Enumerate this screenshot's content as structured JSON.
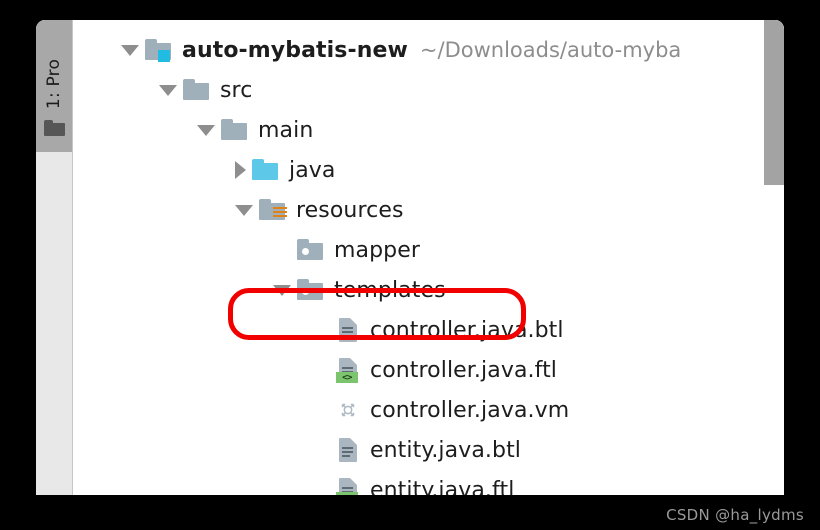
{
  "tool_window": {
    "tab_label": "1: Pro",
    "tab_icon": "project-folder-icon"
  },
  "tree": {
    "rows": [
      {
        "label": "auto-mybatis-new",
        "path": "~/Downloads/auto-myba",
        "icon": "module-folder-icon",
        "arrow": "down",
        "depth": 0,
        "bold": true
      },
      {
        "label": "src",
        "icon": "folder-icon",
        "arrow": "down",
        "depth": 1,
        "bold": false
      },
      {
        "label": "main",
        "icon": "folder-icon",
        "arrow": "down",
        "depth": 2,
        "bold": false
      },
      {
        "label": "java",
        "icon": "source-folder-icon",
        "arrow": "right",
        "depth": 3,
        "bold": false
      },
      {
        "label": "resources",
        "icon": "resources-folder-icon",
        "arrow": "down",
        "depth": 3,
        "bold": false
      },
      {
        "label": "mapper",
        "icon": "package-folder-icon",
        "arrow": "none",
        "depth": 4,
        "bold": false
      },
      {
        "label": "templates",
        "icon": "package-folder-icon",
        "arrow": "down",
        "depth": 4,
        "bold": false
      },
      {
        "label": "controller.java.btl",
        "icon": "text-file-icon",
        "arrow": "none",
        "depth": 5,
        "bold": false
      },
      {
        "label": "controller.java.ftl",
        "icon": "freemarker-file-icon",
        "arrow": "none",
        "depth": 5,
        "bold": false
      },
      {
        "label": "controller.java.vm",
        "icon": "velocity-file-icon",
        "arrow": "none",
        "depth": 5,
        "bold": false
      },
      {
        "label": "entity.java.btl",
        "icon": "text-file-icon",
        "arrow": "none",
        "depth": 5,
        "bold": false
      },
      {
        "label": "entity.java.ftl",
        "icon": "freemarker-file-icon",
        "arrow": "none",
        "depth": 5,
        "bold": false
      }
    ]
  },
  "annotation": {
    "shape": "ellipse",
    "color": "#f20000",
    "target": "templates"
  },
  "scrollbar": {
    "orientation": "vertical",
    "color": "#a3a3a3"
  },
  "watermark": {
    "text": "CSDN @ha_lydms"
  },
  "colors": {
    "folder": "#9fb0bb",
    "source_folder": "#5ec8e8",
    "module_badge": "#22bce3",
    "resources_stripe": "#e08214",
    "freemarker_badge": "#7cc46d",
    "panel_bg": "#ffffff",
    "toolstrip_bg": "#e8e8e8",
    "tab_bg": "#a8a8a8",
    "outer_bg": "#000000"
  }
}
